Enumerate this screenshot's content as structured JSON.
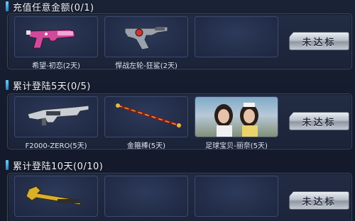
{
  "sections": [
    {
      "title": "充值任意金额(0/1)",
      "status_label": "未达标",
      "items": [
        {
          "label": "希望-初恋(2天)",
          "icon": "pink-pistol-icon"
        },
        {
          "label": "悍战左轮-狂鲨(2天)",
          "icon": "revolver-icon"
        },
        {
          "label": "",
          "icon": ""
        }
      ]
    },
    {
      "title": "累计登陆5天(0/5)",
      "status_label": "未达标",
      "items": [
        {
          "label": "F2000-ZERO(5天)",
          "icon": "assault-rifle-icon"
        },
        {
          "label": "金箍棒(5天)",
          "icon": "staff-icon"
        },
        {
          "label": "足球宝贝-丽奈(5天)",
          "icon": "character-portrait-icon"
        }
      ]
    },
    {
      "title": "累计登陆10天(0/10)",
      "status_label": "未达标",
      "items": [
        {
          "label": "",
          "icon": "wrench-icon"
        },
        {
          "label": "",
          "icon": ""
        },
        {
          "label": "",
          "icon": ""
        }
      ]
    }
  ]
}
